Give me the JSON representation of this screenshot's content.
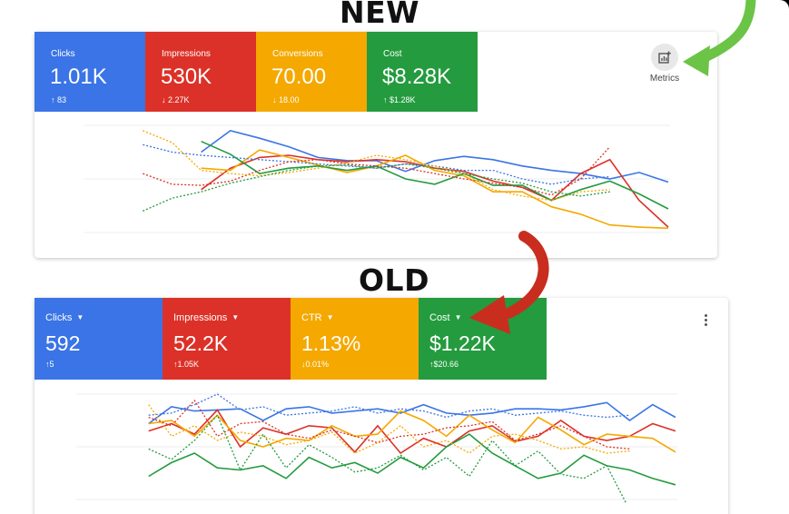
{
  "headings": {
    "new": "NEW",
    "old": "OLD"
  },
  "new_panel": {
    "tiles": [
      {
        "label": "Clicks",
        "value": "1.01K",
        "delta": "83",
        "direction": "up",
        "color": "#3a74e6"
      },
      {
        "label": "Impressions",
        "value": "530K",
        "delta": "2.27K",
        "direction": "down",
        "color": "#dc3128"
      },
      {
        "label": "Conversions",
        "value": "70.00",
        "delta": "18.00",
        "direction": "down",
        "color": "#f5a800"
      },
      {
        "label": "Cost",
        "value": "$8.28K",
        "delta": "$1.28K",
        "direction": "up",
        "color": "#249b3e"
      }
    ],
    "metrics_button": {
      "label": "Metrics",
      "icon": "add-chart-icon"
    }
  },
  "old_panel": {
    "tiles": [
      {
        "label": "Clicks",
        "value": "592",
        "delta": "5",
        "direction": "up",
        "color": "#3a74e6"
      },
      {
        "label": "Impressions",
        "value": "52.2K",
        "delta": "1.05K",
        "direction": "up",
        "color": "#dc3128"
      },
      {
        "label": "CTR",
        "value": "1.13%",
        "delta": "0.01%",
        "direction": "down",
        "color": "#f5a800"
      },
      {
        "label": "Cost",
        "value": "$1.22K",
        "delta": "$20.66",
        "direction": "up",
        "color": "#249b3e"
      }
    ],
    "more_button_icon": "more-vert-icon"
  },
  "glyphs": {
    "up": "↑",
    "down": "↓",
    "dropdown": "▼"
  },
  "chart_data": [
    {
      "type": "line",
      "ylim": [
        0,
        100
      ],
      "series": [
        {
          "color": "#3a74e6",
          "style": "solid",
          "values": [
            null,
            null,
            null,
            null,
            75,
            95,
            88,
            80,
            70,
            67,
            67,
            57,
            67,
            71,
            68,
            62,
            58,
            55,
            50,
            56,
            47
          ]
        },
        {
          "color": "#dc3128",
          "style": "solid",
          "values": [
            null,
            null,
            null,
            null,
            40,
            60,
            70,
            72,
            68,
            66,
            68,
            66,
            60,
            57,
            48,
            42,
            30,
            55,
            68,
            30,
            5
          ]
        },
        {
          "color": "#f5a800",
          "style": "solid",
          "values": [
            null,
            null,
            null,
            null,
            60,
            58,
            77,
            70,
            63,
            56,
            62,
            72,
            58,
            53,
            38,
            38,
            24,
            17,
            7,
            5,
            4
          ]
        },
        {
          "color": "#249b3e",
          "style": "solid",
          "values": [
            null,
            null,
            null,
            null,
            85,
            73,
            55,
            60,
            62,
            58,
            62,
            50,
            45,
            55,
            44,
            44,
            30,
            40,
            48,
            36,
            22
          ]
        },
        {
          "color": "#3a74e6",
          "style": "dotted",
          "values": [
            null,
            null,
            82,
            75,
            72,
            70,
            68,
            66,
            64,
            62,
            60,
            64,
            62,
            58,
            58,
            50,
            45,
            50,
            52,
            null,
            null
          ]
        },
        {
          "color": "#dc3128",
          "style": "dotted",
          "values": [
            null,
            null,
            55,
            45,
            44,
            48,
            58,
            66,
            68,
            64,
            62,
            60,
            55,
            50,
            46,
            42,
            35,
            50,
            80,
            null,
            null
          ]
        },
        {
          "color": "#f5a800",
          "style": "dotted",
          "values": [
            null,
            null,
            95,
            84,
            58,
            55,
            53,
            56,
            60,
            65,
            72,
            68,
            62,
            55,
            40,
            34,
            30,
            38,
            40,
            null,
            null
          ]
        },
        {
          "color": "#249b3e",
          "style": "dotted",
          "values": [
            null,
            null,
            20,
            32,
            38,
            46,
            52,
            58,
            62,
            63,
            60,
            64,
            60,
            55,
            50,
            46,
            38,
            34,
            38,
            null,
            null
          ]
        }
      ]
    },
    {
      "type": "line",
      "ylim": [
        0,
        100
      ],
      "series": [
        {
          "color": "#3a74e6",
          "style": "solid",
          "values": [
            null,
            null,
            null,
            72,
            88,
            84,
            85,
            86,
            75,
            86,
            88,
            82,
            84,
            86,
            82,
            90,
            82,
            80,
            82,
            86,
            86,
            85,
            88,
            92,
            75,
            90,
            78
          ]
        },
        {
          "color": "#dc3128",
          "style": "solid",
          "values": [
            null,
            null,
            null,
            65,
            72,
            62,
            85,
            50,
            68,
            62,
            70,
            68,
            45,
            70,
            44,
            58,
            50,
            65,
            70,
            55,
            60,
            75,
            60,
            56,
            60,
            72,
            65
          ]
        },
        {
          "color": "#f5a800",
          "style": "solid",
          "values": [
            null,
            null,
            null,
            72,
            75,
            60,
            80,
            56,
            50,
            58,
            56,
            70,
            60,
            62,
            84,
            75,
            60,
            80,
            66,
            54,
            78,
            66,
            52,
            62,
            60,
            58,
            45
          ]
        },
        {
          "color": "#249b3e",
          "style": "solid",
          "values": [
            null,
            null,
            null,
            22,
            35,
            44,
            30,
            28,
            32,
            20,
            40,
            30,
            35,
            25,
            40,
            30,
            50,
            62,
            44,
            32,
            20,
            25,
            42,
            32,
            28,
            20,
            14
          ]
        },
        {
          "color": "#3a74e6",
          "style": "dotted",
          "values": [
            null,
            null,
            null,
            80,
            82,
            90,
            100,
            85,
            88,
            80,
            82,
            84,
            88,
            82,
            86,
            84,
            78,
            84,
            86,
            80,
            82,
            84,
            80,
            78,
            80,
            null,
            null
          ]
        },
        {
          "color": "#dc3128",
          "style": "dotted",
          "values": [
            null,
            null,
            null,
            78,
            70,
            94,
            60,
            72,
            74,
            62,
            58,
            66,
            60,
            54,
            60,
            62,
            68,
            70,
            74,
            56,
            62,
            70,
            60,
            50,
            48,
            null,
            null
          ]
        },
        {
          "color": "#f5a800",
          "style": "dotted",
          "values": [
            null,
            null,
            null,
            90,
            60,
            70,
            56,
            64,
            60,
            52,
            56,
            64,
            44,
            54,
            70,
            50,
            56,
            44,
            60,
            62,
            56,
            48,
            50,
            44,
            46,
            null,
            null
          ]
        },
        {
          "color": "#249b3e",
          "style": "dotted",
          "values": [
            null,
            null,
            null,
            48,
            38,
            56,
            80,
            28,
            62,
            30,
            52,
            40,
            26,
            30,
            42,
            28,
            40,
            22,
            56,
            32,
            46,
            24,
            20,
            32,
            -10,
            null,
            null
          ]
        }
      ]
    }
  ]
}
